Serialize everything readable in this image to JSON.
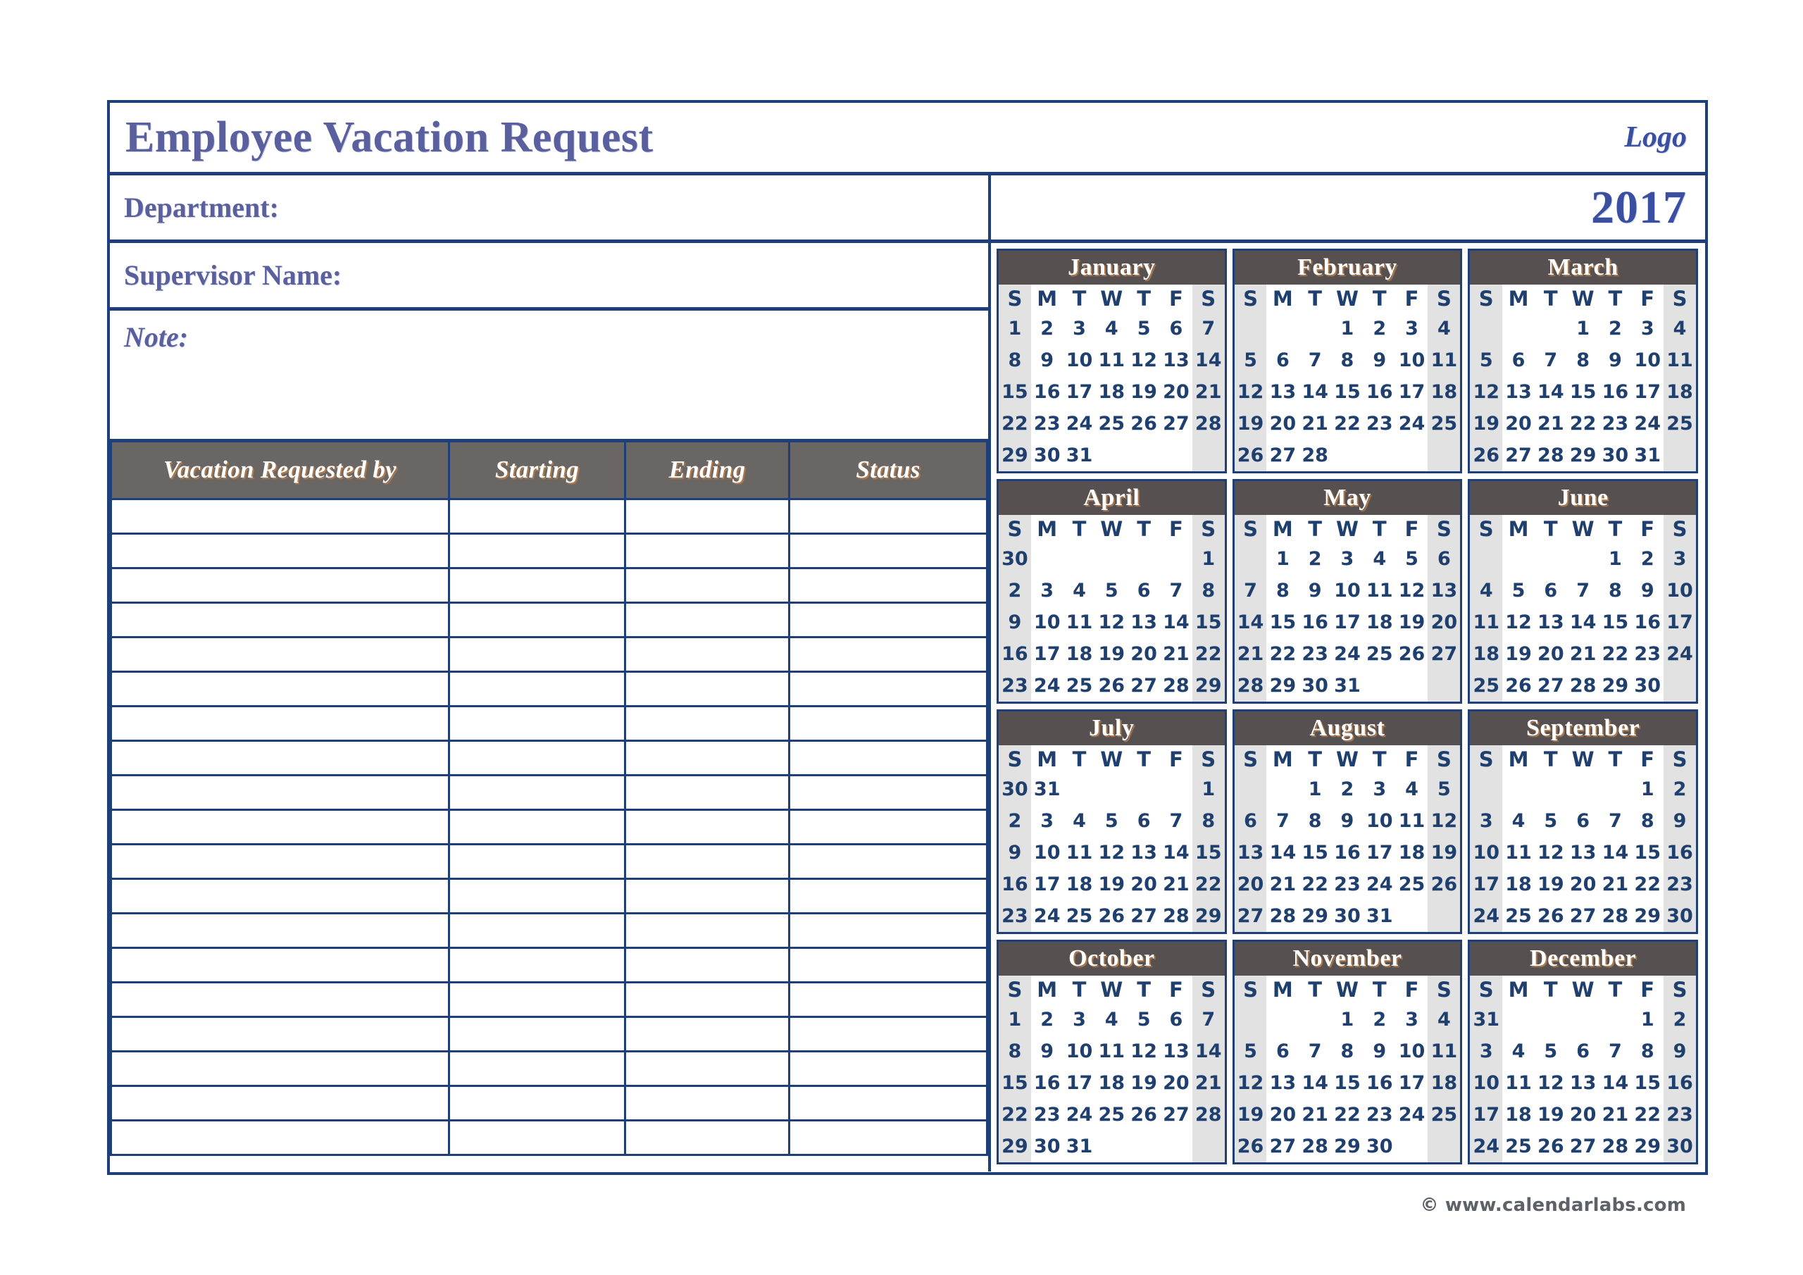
{
  "header": {
    "title": "Employee Vacation Request",
    "logo": "Logo"
  },
  "form": {
    "department_label": "Department:",
    "supervisor_label": "Supervisor Name:",
    "note_label": "Note:",
    "department_value": "",
    "supervisor_value": "",
    "note_value": ""
  },
  "request_table": {
    "columns": [
      "Vacation Requested by",
      "Starting",
      "Ending",
      "Status"
    ],
    "row_count": 19,
    "rows": [
      [
        "",
        "",
        "",
        ""
      ],
      [
        "",
        "",
        "",
        ""
      ],
      [
        "",
        "",
        "",
        ""
      ],
      [
        "",
        "",
        "",
        ""
      ],
      [
        "",
        "",
        "",
        ""
      ],
      [
        "",
        "",
        "",
        ""
      ],
      [
        "",
        "",
        "",
        ""
      ],
      [
        "",
        "",
        "",
        ""
      ],
      [
        "",
        "",
        "",
        ""
      ],
      [
        "",
        "",
        "",
        ""
      ],
      [
        "",
        "",
        "",
        ""
      ],
      [
        "",
        "",
        "",
        ""
      ],
      [
        "",
        "",
        "",
        ""
      ],
      [
        "",
        "",
        "",
        ""
      ],
      [
        "",
        "",
        "",
        ""
      ],
      [
        "",
        "",
        "",
        ""
      ],
      [
        "",
        "",
        "",
        ""
      ],
      [
        "",
        "",
        "",
        ""
      ],
      [
        "",
        "",
        "",
        ""
      ]
    ]
  },
  "calendar": {
    "year": "2017",
    "weekday_headers": [
      "S",
      "M",
      "T",
      "W",
      "T",
      "F",
      "S"
    ],
    "weekend_columns": [
      0,
      6
    ],
    "months": [
      {
        "name": "January",
        "weeks": [
          [
            "1",
            "2",
            "3",
            "4",
            "5",
            "6",
            "7"
          ],
          [
            "8",
            "9",
            "10",
            "11",
            "12",
            "13",
            "14"
          ],
          [
            "15",
            "16",
            "17",
            "18",
            "19",
            "20",
            "21"
          ],
          [
            "22",
            "23",
            "24",
            "25",
            "26",
            "27",
            "28"
          ],
          [
            "29",
            "30",
            "31",
            "",
            "",
            "",
            ""
          ]
        ]
      },
      {
        "name": "February",
        "weeks": [
          [
            "",
            "",
            "",
            "1",
            "2",
            "3",
            "4"
          ],
          [
            "5",
            "6",
            "7",
            "8",
            "9",
            "10",
            "11"
          ],
          [
            "12",
            "13",
            "14",
            "15",
            "16",
            "17",
            "18"
          ],
          [
            "19",
            "20",
            "21",
            "22",
            "23",
            "24",
            "25"
          ],
          [
            "26",
            "27",
            "28",
            "",
            "",
            "",
            ""
          ]
        ]
      },
      {
        "name": "March",
        "weeks": [
          [
            "",
            "",
            "",
            "1",
            "2",
            "3",
            "4"
          ],
          [
            "5",
            "6",
            "7",
            "8",
            "9",
            "10",
            "11"
          ],
          [
            "12",
            "13",
            "14",
            "15",
            "16",
            "17",
            "18"
          ],
          [
            "19",
            "20",
            "21",
            "22",
            "23",
            "24",
            "25"
          ],
          [
            "26",
            "27",
            "28",
            "29",
            "30",
            "31",
            ""
          ]
        ]
      },
      {
        "name": "April",
        "weeks": [
          [
            "30",
            "",
            "",
            "",
            "",
            "",
            "1"
          ],
          [
            "2",
            "3",
            "4",
            "5",
            "6",
            "7",
            "8"
          ],
          [
            "9",
            "10",
            "11",
            "12",
            "13",
            "14",
            "15"
          ],
          [
            "16",
            "17",
            "18",
            "19",
            "20",
            "21",
            "22"
          ],
          [
            "23",
            "24",
            "25",
            "26",
            "27",
            "28",
            "29"
          ]
        ]
      },
      {
        "name": "May",
        "weeks": [
          [
            "",
            "1",
            "2",
            "3",
            "4",
            "5",
            "6"
          ],
          [
            "7",
            "8",
            "9",
            "10",
            "11",
            "12",
            "13"
          ],
          [
            "14",
            "15",
            "16",
            "17",
            "18",
            "19",
            "20"
          ],
          [
            "21",
            "22",
            "23",
            "24",
            "25",
            "26",
            "27"
          ],
          [
            "28",
            "29",
            "30",
            "31",
            "",
            "",
            ""
          ]
        ]
      },
      {
        "name": "June",
        "weeks": [
          [
            "",
            "",
            "",
            "",
            "1",
            "2",
            "3"
          ],
          [
            "4",
            "5",
            "6",
            "7",
            "8",
            "9",
            "10"
          ],
          [
            "11",
            "12",
            "13",
            "14",
            "15",
            "16",
            "17"
          ],
          [
            "18",
            "19",
            "20",
            "21",
            "22",
            "23",
            "24"
          ],
          [
            "25",
            "26",
            "27",
            "28",
            "29",
            "30",
            ""
          ]
        ]
      },
      {
        "name": "July",
        "weeks": [
          [
            "30",
            "31",
            "",
            "",
            "",
            "",
            "1"
          ],
          [
            "2",
            "3",
            "4",
            "5",
            "6",
            "7",
            "8"
          ],
          [
            "9",
            "10",
            "11",
            "12",
            "13",
            "14",
            "15"
          ],
          [
            "16",
            "17",
            "18",
            "19",
            "20",
            "21",
            "22"
          ],
          [
            "23",
            "24",
            "25",
            "26",
            "27",
            "28",
            "29"
          ]
        ]
      },
      {
        "name": "August",
        "weeks": [
          [
            "",
            "",
            "1",
            "2",
            "3",
            "4",
            "5"
          ],
          [
            "6",
            "7",
            "8",
            "9",
            "10",
            "11",
            "12"
          ],
          [
            "13",
            "14",
            "15",
            "16",
            "17",
            "18",
            "19"
          ],
          [
            "20",
            "21",
            "22",
            "23",
            "24",
            "25",
            "26"
          ],
          [
            "27",
            "28",
            "29",
            "30",
            "31",
            "",
            ""
          ]
        ]
      },
      {
        "name": "September",
        "weeks": [
          [
            "",
            "",
            "",
            "",
            "",
            "1",
            "2"
          ],
          [
            "3",
            "4",
            "5",
            "6",
            "7",
            "8",
            "9"
          ],
          [
            "10",
            "11",
            "12",
            "13",
            "14",
            "15",
            "16"
          ],
          [
            "17",
            "18",
            "19",
            "20",
            "21",
            "22",
            "23"
          ],
          [
            "24",
            "25",
            "26",
            "27",
            "28",
            "29",
            "30"
          ]
        ]
      },
      {
        "name": "October",
        "weeks": [
          [
            "1",
            "2",
            "3",
            "4",
            "5",
            "6",
            "7"
          ],
          [
            "8",
            "9",
            "10",
            "11",
            "12",
            "13",
            "14"
          ],
          [
            "15",
            "16",
            "17",
            "18",
            "19",
            "20",
            "21"
          ],
          [
            "22",
            "23",
            "24",
            "25",
            "26",
            "27",
            "28"
          ],
          [
            "29",
            "30",
            "31",
            "",
            "",
            "",
            ""
          ]
        ]
      },
      {
        "name": "November",
        "weeks": [
          [
            "",
            "",
            "",
            "1",
            "2",
            "3",
            "4"
          ],
          [
            "5",
            "6",
            "7",
            "8",
            "9",
            "10",
            "11"
          ],
          [
            "12",
            "13",
            "14",
            "15",
            "16",
            "17",
            "18"
          ],
          [
            "19",
            "20",
            "21",
            "22",
            "23",
            "24",
            "25"
          ],
          [
            "26",
            "27",
            "28",
            "29",
            "30",
            "",
            ""
          ]
        ]
      },
      {
        "name": "December",
        "weeks": [
          [
            "31",
            "",
            "",
            "",
            "",
            "1",
            "2"
          ],
          [
            "3",
            "4",
            "5",
            "6",
            "7",
            "8",
            "9"
          ],
          [
            "10",
            "11",
            "12",
            "13",
            "14",
            "15",
            "16"
          ],
          [
            "17",
            "18",
            "19",
            "20",
            "21",
            "22",
            "23"
          ],
          [
            "24",
            "25",
            "26",
            "27",
            "28",
            "29",
            "30"
          ]
        ]
      }
    ]
  },
  "footer": {
    "copyright": "© www.calendarlabs.com"
  },
  "colors": {
    "border": "#1f3f7a",
    "title_text": "#5a5f9e",
    "year_text": "#3b4fa0",
    "header_fill": "#565150",
    "table_header_fill": "#6a6664",
    "weekend_fill": "#e2e2e2",
    "day_text": "#1f3f6e"
  }
}
